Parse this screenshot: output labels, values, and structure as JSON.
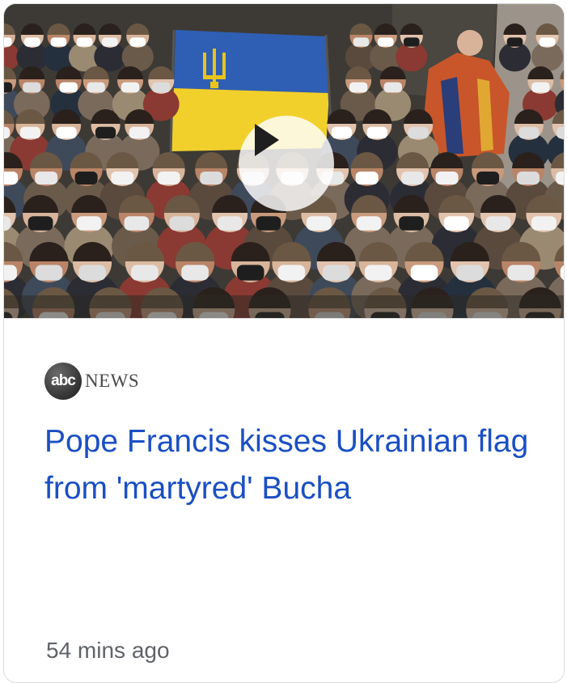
{
  "card": {
    "source": {
      "logo_text": "abc",
      "name": "NEWS"
    },
    "headline": "Pope Francis kisses Ukrainian flag from 'martyred' Bucha",
    "timestamp": "54 mins ago",
    "thumbnail": {
      "icon": "play-icon",
      "flag_colors": [
        "#2f5fb4",
        "#f2d02c"
      ],
      "trident_color": "#e9c419"
    }
  }
}
